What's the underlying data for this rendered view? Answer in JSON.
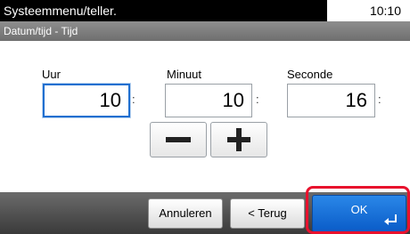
{
  "header": {
    "title": "Systeemmenu/teller.",
    "clock": "10:10"
  },
  "subheader": {
    "breadcrumb": "Datum/tijd - Tijd"
  },
  "fields": {
    "hour": {
      "label": "Uur",
      "value": "10"
    },
    "minute": {
      "label": "Minuut",
      "value": "10"
    },
    "second": {
      "label": "Seconde",
      "value": "16"
    },
    "separator": ":"
  },
  "stepper": {
    "decrement_icon": "minus-icon",
    "increment_icon": "plus-icon"
  },
  "footer": {
    "cancel_label": "Annuleren",
    "back_label": "< Terug",
    "ok_label": "OK",
    "ok_icon": "enter-icon"
  },
  "colors": {
    "accent_blue": "#1f6fd0",
    "ok_blue": "#0a5cc8",
    "highlight_red": "#e8112d"
  }
}
